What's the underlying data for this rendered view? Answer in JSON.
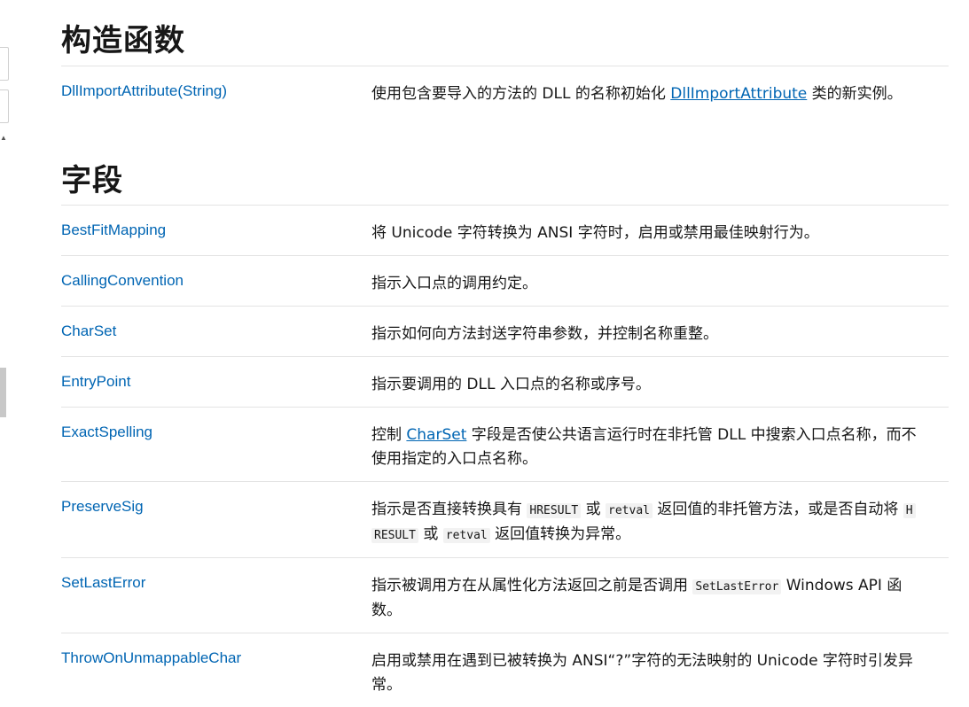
{
  "sections": {
    "constructors_title": "构造函数",
    "fields_title": "字段"
  },
  "constructor": {
    "name": "DllImportAttribute(String)",
    "desc_before": "使用包含要导入的方法的 DLL 的名称初始化 ",
    "desc_link": "DllImportAttribute",
    "desc_after": " 类的新实例。"
  },
  "fields": [
    {
      "name": "BestFitMapping",
      "desc": "将 Unicode 字符转换为 ANSI 字符时，启用或禁用最佳映射行为。"
    },
    {
      "name": "CallingConvention",
      "desc": "指示入口点的调用约定。"
    },
    {
      "name": "CharSet",
      "desc": "指示如何向方法封送字符串参数，并控制名称重整。"
    },
    {
      "name": "EntryPoint",
      "desc": "指示要调用的 DLL 入口点的名称或序号。"
    },
    {
      "name": "ExactSpelling",
      "desc_before": "控制 ",
      "desc_link": "CharSet",
      "desc_after": " 字段是否使公共语言运行时在非托管 DLL 中搜索入口点名称，而不使用指定的入口点名称。"
    },
    {
      "name": "PreserveSig",
      "desc_1": "指示是否直接转换具有 ",
      "code_1": "HRESULT",
      "desc_2": " 或 ",
      "code_2": "retval",
      "desc_3": " 返回值的非托管方法，或是否自动将 ",
      "code_3a": "H",
      "code_3b": "RESULT",
      "desc_4": " 或 ",
      "code_4": "retval",
      "desc_5": " 返回值转换为异常。"
    },
    {
      "name": "SetLastError",
      "desc_1": "指示被调用方在从属性化方法返回之前是否调用 ",
      "code_1": "SetLastError",
      "desc_2": " Windows API 函数。"
    },
    {
      "name": "ThrowOnUnmappableChar",
      "desc": "启用或禁用在遇到已被转换为 ANSI“?”字符的无法映射的 Unicode 字符时引发异常。"
    }
  ]
}
